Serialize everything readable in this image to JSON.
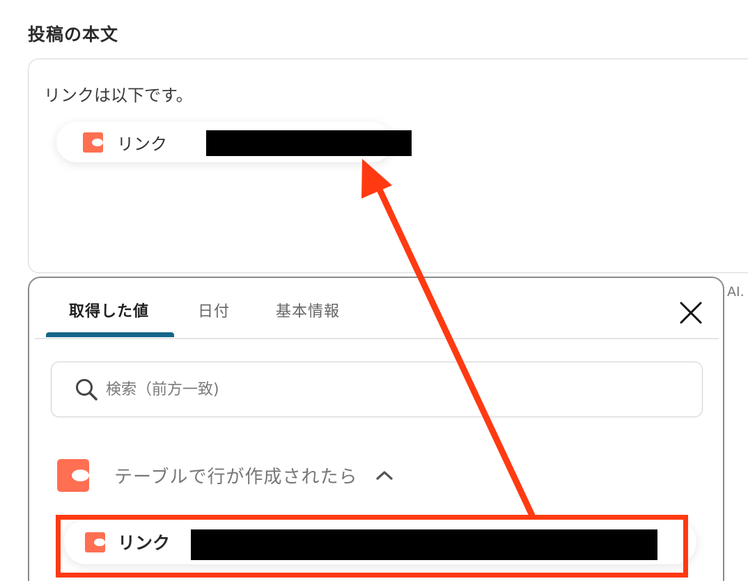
{
  "section": {
    "title": "投稿の本文"
  },
  "editor": {
    "text": "リンクは以下です。",
    "chip": {
      "label": "リンク",
      "value_redacted": true
    }
  },
  "side_text": "AI.",
  "panel": {
    "tabs": [
      {
        "label": "取得した値",
        "active": true
      },
      {
        "label": "日付",
        "active": false
      },
      {
        "label": "基本情報",
        "active": false
      }
    ],
    "search": {
      "placeholder": "検索（前方一致)"
    },
    "group": {
      "title": "テーブルで行が作成されたら",
      "expanded": true,
      "items": [
        {
          "label": "リンク",
          "value_redacted": true
        }
      ]
    }
  },
  "icons": {
    "app": "coda-app-icon",
    "search": "search-icon",
    "close": "close-icon",
    "chevron": "chevron-up-icon"
  },
  "colors": {
    "app_logo": "#ff6f52",
    "tab_underline": "#15668a",
    "annotation": "#ff3a12"
  }
}
